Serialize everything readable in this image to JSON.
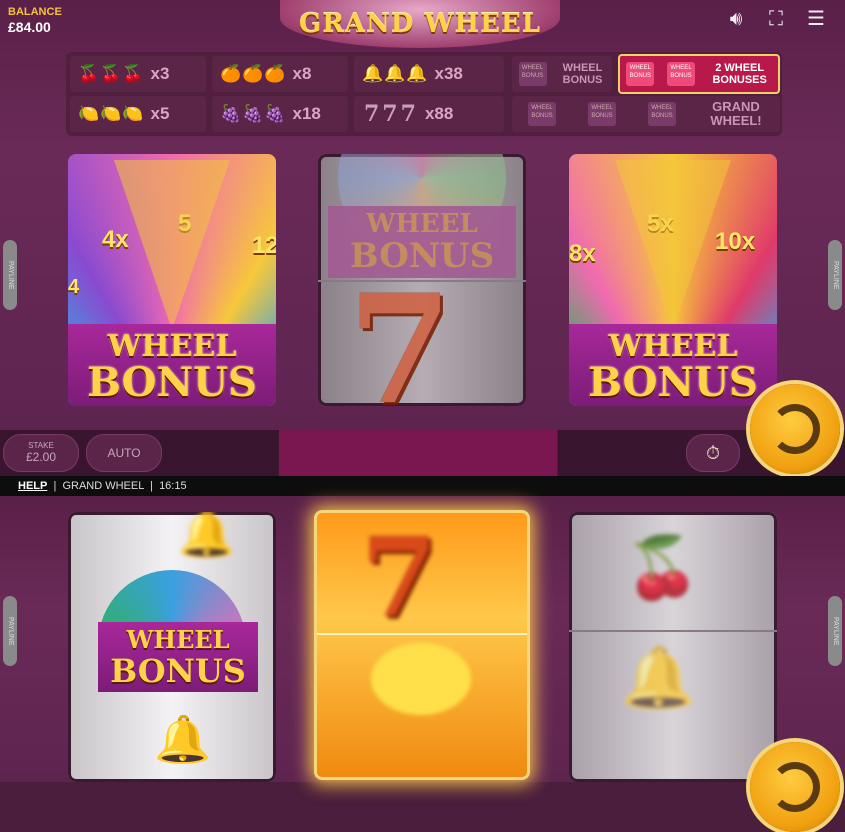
{
  "balance": {
    "label": "BALANCE",
    "value": "£84.00"
  },
  "game_title": "GRAND WHEEL",
  "paytable": {
    "rows": [
      [
        {
          "icons": "🍒🍒🍒",
          "mult": "x3"
        },
        {
          "icons": "🍊🍊🍊",
          "mult": "x8"
        },
        {
          "icons": "🔔🔔🔔",
          "mult": "x38"
        }
      ],
      [
        {
          "icons": "🍋🍋🍋",
          "mult": "x5"
        },
        {
          "icons": "🍇🍇🍇",
          "mult": "x18"
        },
        {
          "icons": "777",
          "mult": "x88"
        }
      ]
    ],
    "bonus_cells": [
      {
        "label": "WHEEL BONUS",
        "badges": 1,
        "highlight": false
      },
      {
        "label": "2 WHEEL BONUSES",
        "badges": 2,
        "highlight": true
      },
      {
        "label": "GRAND WHEEL!",
        "badges": 3,
        "highlight": false
      }
    ],
    "badge_text": "WHEEL BONUS"
  },
  "reels_top": {
    "left": {
      "segments": [
        "4",
        "4x",
        "5",
        "12"
      ],
      "banner": [
        "WHEEL",
        "BONUS"
      ]
    },
    "middle": {
      "banner": [
        "WHEEL",
        "BONUS"
      ],
      "symbol": "7"
    },
    "right": {
      "segments": [
        "8x",
        "5x",
        "10x"
      ],
      "banner": [
        "WHEEL",
        "BONUS"
      ]
    }
  },
  "payline_label": "PAYLINE",
  "controls": {
    "stake_label": "STAKE",
    "stake_value": "£2.00",
    "auto_label": "AUTO"
  },
  "help_bar": {
    "help": "HELP",
    "game": "GRAND WHEEL",
    "time": "16:15"
  },
  "reels_bottom": {
    "left": {
      "banner": [
        "WHEEL",
        "BONUS"
      ]
    },
    "middle": {
      "symbol": "7"
    }
  },
  "colors": {
    "background": "#5a2048",
    "gold": "#ffd24a",
    "accent": "#b8184a",
    "spin": "#f0a010"
  }
}
